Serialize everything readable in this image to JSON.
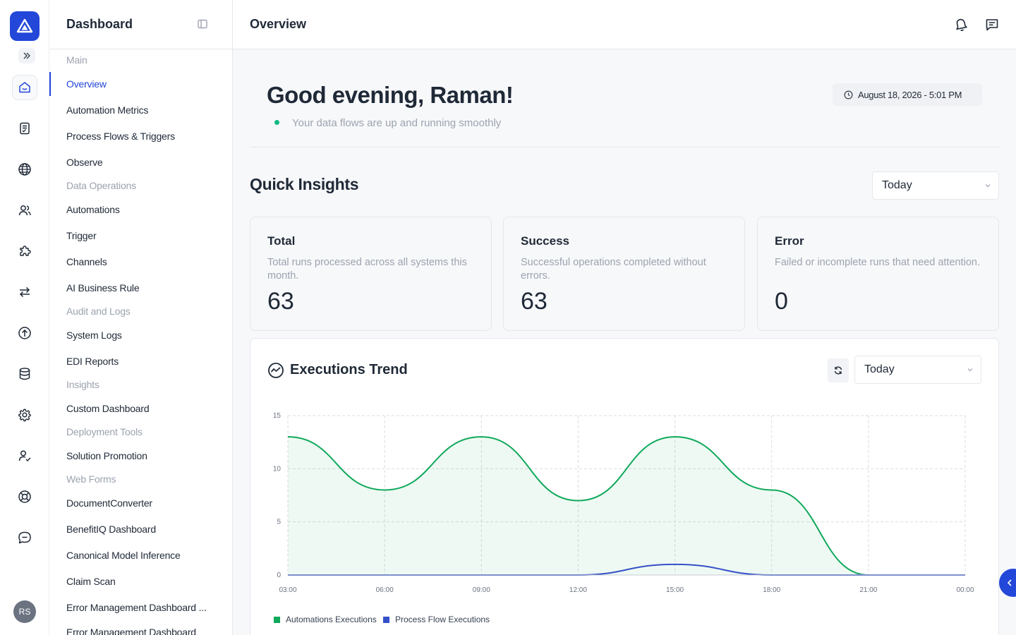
{
  "sidebar": {
    "title": "Dashboard",
    "sections": [
      "Main",
      "Data Operations",
      "Audit and Logs",
      "Insights",
      "Deployment Tools",
      "Web Forms"
    ],
    "items": [
      "Overview",
      "Automation Metrics",
      "Process Flows & Triggers",
      "Observe",
      "Automations",
      "Trigger",
      "Channels",
      "AI Business Rule",
      "System Logs",
      "EDI Reports",
      "Custom Dashboard",
      "Solution Promotion",
      "DocumentConverter",
      "BenefitIQ Dashboard",
      "Canonical Model Inference",
      "Claim Scan",
      "Error Management Dashboard ...",
      "Error Management Dashboard"
    ]
  },
  "rail": {
    "icons": [
      "home-icon",
      "document-check-icon",
      "globe-icon",
      "users-icon",
      "puzzle-icon",
      "arrows-exchange-icon",
      "upload-circle-icon",
      "database-icon",
      "settings-icon",
      "user-check-icon",
      "lifebuoy-icon",
      "chat-icon"
    ],
    "avatar_initials": "RS"
  },
  "header": {
    "title": "Overview"
  },
  "greeting": {
    "title": "Good evening, Raman!",
    "status": "Your data flows are up and running smoothly",
    "date": "August 18, 2026 - 5:01 PM"
  },
  "insights": {
    "title": "Quick Insights",
    "period": "Today",
    "cards": [
      {
        "title": "Total",
        "description": "Total runs processed across all systems this month.",
        "value": "63"
      },
      {
        "title": "Success",
        "description": "Successful operations completed without errors.",
        "value": "63"
      },
      {
        "title": "Error",
        "description": "Failed or incomplete runs that need attention.",
        "value": "0"
      }
    ]
  },
  "trend": {
    "title": "Executions Trend",
    "period": "Today"
  },
  "chart_data": {
    "type": "area",
    "title": "Executions Trend",
    "x": [
      "03:00",
      "06:00",
      "09:00",
      "12:00",
      "15:00",
      "18:00",
      "21:00",
      "00:00"
    ],
    "y_ticks": [
      0,
      5,
      10,
      15
    ],
    "ylim": [
      0,
      15
    ],
    "grid": true,
    "legend_position": "bottom-left",
    "series": [
      {
        "name": "Automations Executions",
        "color": "#10a95b",
        "values": [
          13,
          8,
          13,
          7,
          13,
          8,
          0,
          0
        ]
      },
      {
        "name": "Process Flow Executions",
        "color": "#3550c8",
        "values": [
          0,
          0,
          0,
          0,
          1,
          0,
          0,
          0
        ]
      }
    ]
  }
}
